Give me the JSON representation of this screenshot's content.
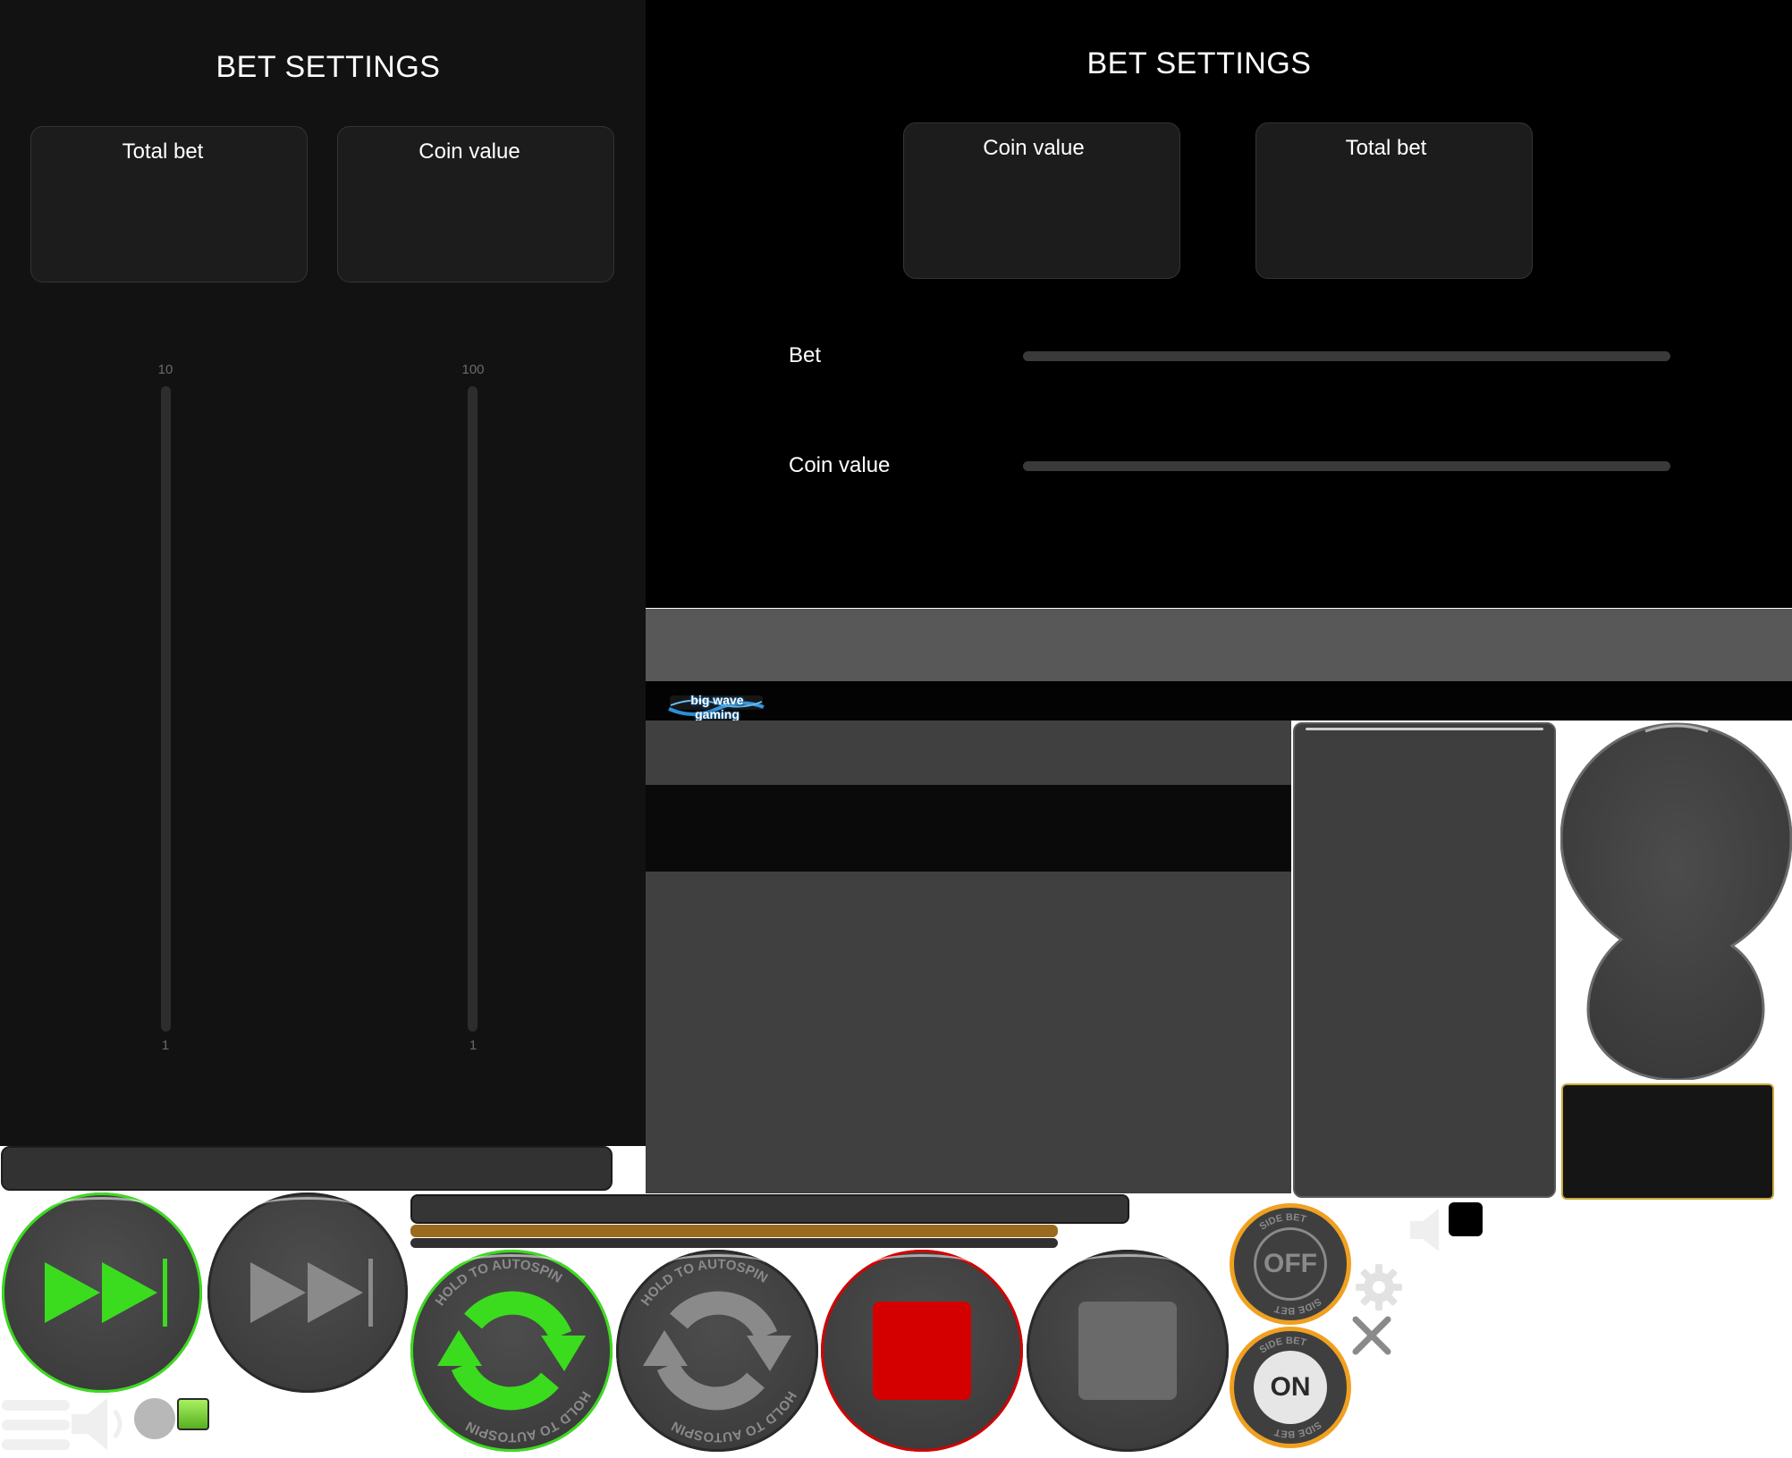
{
  "left_panel": {
    "title": "BET SETTINGS",
    "total_bet_label": "Total bet",
    "coin_value_label": "Coin value",
    "slider_total_bet": {
      "max": "10",
      "min": "1"
    },
    "slider_coin_value": {
      "max": "100",
      "min": "1"
    }
  },
  "right_panel": {
    "title": "BET SETTINGS",
    "coin_value_label": "Coin value",
    "total_bet_label": "Total bet",
    "bet_row_label": "Bet",
    "coin_value_row_label": "Coin value"
  },
  "logo": {
    "text": "big wave gaming"
  },
  "buttons": {
    "autospin_ring_text": "HOLD TO AUTOSPIN",
    "side_bet_ring_text": "SIDE BET",
    "side_bet_off": "OFF",
    "side_bet_on": "ON"
  },
  "colors": {
    "active_green": "#3bdc1e",
    "stop_red": "#d40000",
    "inactive_grey": "#8a8a8a",
    "side_bet_gold": "#f0a020",
    "progress_gold": "#9a6a1e"
  },
  "icons": [
    "fast-forward-icon",
    "autospin-icon",
    "stop-icon",
    "gear-icon",
    "close-icon",
    "speaker-icon",
    "menu-icon"
  ]
}
